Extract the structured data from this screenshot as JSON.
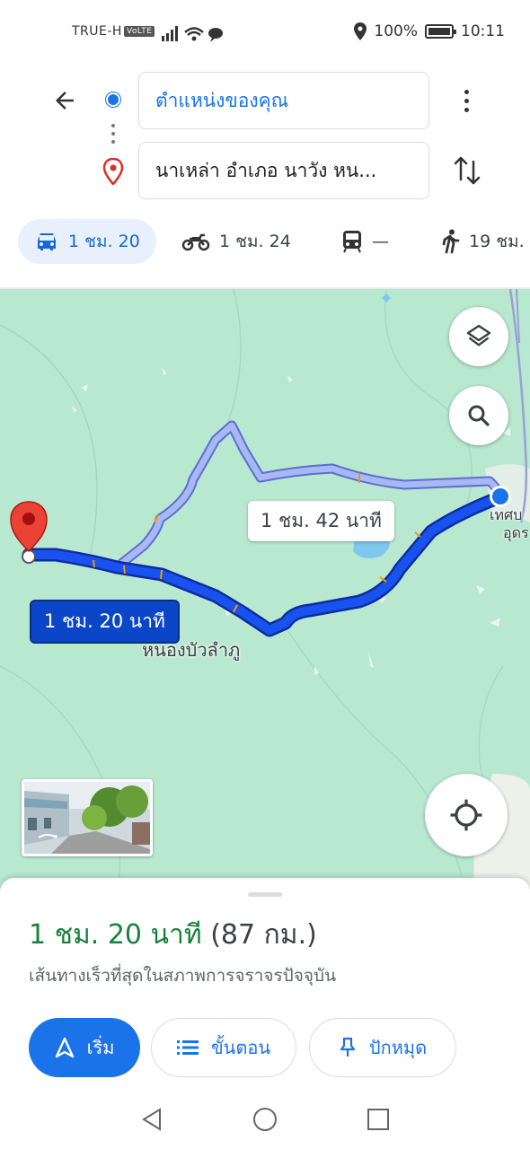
{
  "status_bar": {
    "carrier": "TRUE-H",
    "volte": "VoLTE",
    "battery": "100%",
    "time": "10:11"
  },
  "directions": {
    "origin": "ตำแหน่งของคุณ",
    "destination": "นาเหล่า อำเภอ นาวัง หน..."
  },
  "travel_modes": [
    {
      "mode": "car",
      "icon": "car-icon",
      "label": "1 ชม. 20",
      "active": true
    },
    {
      "mode": "motorcycle",
      "icon": "motorcycle-icon",
      "label": "1 ชม. 24",
      "active": false
    },
    {
      "mode": "transit",
      "icon": "train-icon",
      "label": "—",
      "active": false
    },
    {
      "mode": "walk",
      "icon": "walk-icon",
      "label": "19 ชม.",
      "active": false
    }
  ],
  "map": {
    "alt_route_label": "1 ชม. 42 นาที",
    "main_route_label": "1 ชม. 20 นาที",
    "place_label": "หนองบัวลำภู",
    "city_label_line1": "เทศบ",
    "city_label_line2": "อุดร",
    "colors": {
      "land": "#b8e8cf",
      "route_main": "#1a52f0",
      "route_alt": "#a7b8f5",
      "origin": "#1a73e8",
      "destination_pin": "#ea4335"
    }
  },
  "summary": {
    "time": "1 ชม. 20 นาที",
    "distance": "(87 กม.)",
    "description": "เส้นทางเร็วที่สุดในสภาพการจราจรปัจจุบัน"
  },
  "actions": {
    "start": "เริ่ม",
    "steps": "ขั้นตอน",
    "pin": "ปักหมุด"
  }
}
